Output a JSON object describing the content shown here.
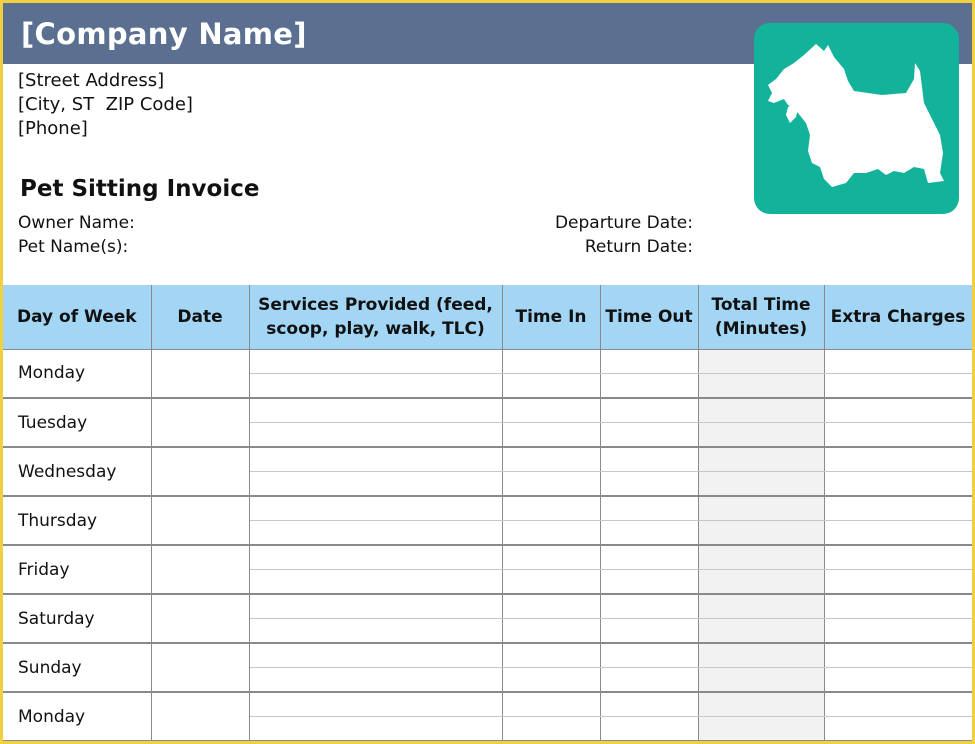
{
  "company": {
    "name": "[Company Name]",
    "address_lines": [
      "[Street Address]",
      "[City, ST  ZIP Code]",
      "[Phone]"
    ]
  },
  "invoice": {
    "title": "Pet Sitting Invoice",
    "owner_label": "Owner Name:",
    "pet_label": "Pet Name(s):",
    "departure_label": "Departure Date:",
    "return_label": "Return Date:"
  },
  "logo": {
    "icon": "scottish-terrier-icon",
    "background": "#12b39a"
  },
  "colors": {
    "header": "#5b7091",
    "table_header": "#a3d5f5",
    "frame": "#f0cf40",
    "total_column": "#f2f2f2"
  },
  "table": {
    "headers": {
      "day": "Day of Week",
      "date": "Date",
      "services_line1": "Services Provided (feed,",
      "services_line2": "scoop, play, walk, TLC)",
      "time_in": "Time In",
      "time_out": "Time Out",
      "total_line1": "Total Time",
      "total_line2": "(Minutes)",
      "extra": "Extra Charges"
    },
    "days": [
      "Monday",
      "Tuesday",
      "Wednesday",
      "Thursday",
      "Friday",
      "Saturday",
      "Sunday",
      "Monday"
    ]
  }
}
